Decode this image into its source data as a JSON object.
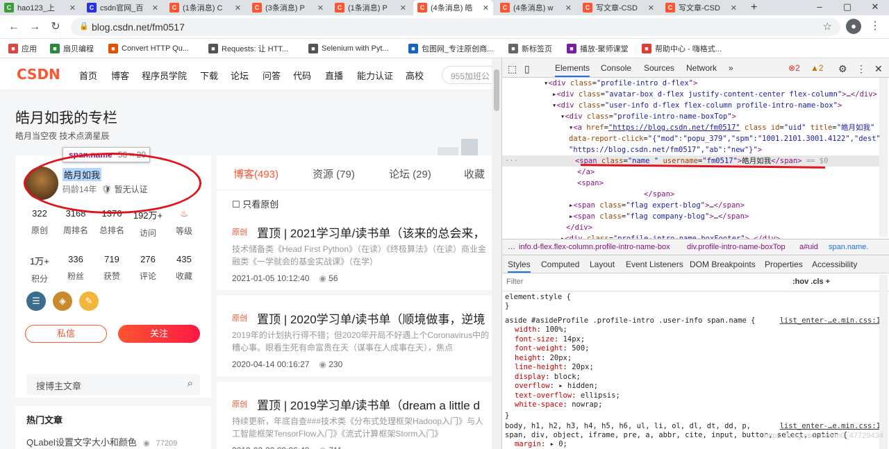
{
  "browser": {
    "tabs": [
      {
        "title": "hao123_上",
        "icon": "hao123-icon",
        "color": "#3a9c3a",
        "active": false
      },
      {
        "title": "csdn官网_百",
        "icon": "baidu-paw-icon",
        "color": "#2932e1",
        "active": false
      },
      {
        "title": "(1条消息) C",
        "icon": "csdn-c-icon",
        "color": "#fc5531",
        "active": false
      },
      {
        "title": "(3条消息) P",
        "icon": "csdn-c-icon",
        "color": "#fc5531",
        "active": false
      },
      {
        "title": "(1条消息) P",
        "icon": "csdn-c-icon",
        "color": "#fc5531",
        "active": false
      },
      {
        "title": "(4条消息) 皓",
        "icon": "csdn-c-icon",
        "color": "#fc5531",
        "active": true
      },
      {
        "title": "(4条消息) w",
        "icon": "csdn-c-icon",
        "color": "#fc5531",
        "active": false
      },
      {
        "title": "写文章-CSD",
        "icon": "csdn-c-icon",
        "color": "#fc5531",
        "active": false
      },
      {
        "title": "写文章-CSD",
        "icon": "csdn-c-icon",
        "color": "#fc5531",
        "active": false
      }
    ],
    "new_tab": "+",
    "url": "blog.csdn.net/fm0517",
    "bookmarks": [
      {
        "label": "应用",
        "icon": "apps-grid-icon",
        "color": "#d44"
      },
      {
        "label": "扇贝编程",
        "icon": "shanbay-icon",
        "color": "#2a8a3a"
      },
      {
        "label": "Convert HTTP Qu...",
        "icon": "convert-icon",
        "color": "#e65100"
      },
      {
        "label": "Requests: 让 HTT...",
        "icon": "doc-icon",
        "color": "#555"
      },
      {
        "label": "Selenium with Pyt...",
        "icon": "doc-icon",
        "color": "#555"
      },
      {
        "label": "包图网_专注原创商...",
        "icon": "baotu-icon",
        "color": "#1565c0"
      },
      {
        "label": "新标签页",
        "icon": "globe-icon",
        "color": "#666"
      },
      {
        "label": "播放-聚师课堂",
        "icon": "play-icon",
        "color": "#7b1fa2"
      },
      {
        "label": "帮助中心 - 嗨格式...",
        "icon": "help-icon",
        "color": "#e53935"
      }
    ]
  },
  "csdn": {
    "logo": "CSDN",
    "nav": [
      "首页",
      "博客",
      "程序员学院",
      "下载",
      "论坛",
      "问答",
      "代码",
      "直播",
      "能力认证",
      "高校"
    ],
    "search_placeholder": "955加班公",
    "blog_title": "皓月如我的专栏",
    "blog_subtitle": "皓月当空夜 技术点滴星辰",
    "tooltip_tag": "span.name",
    "tooltip_size": "56 × 20",
    "profile": {
      "name": "皓月如我",
      "age": "码龄14年",
      "auth": "暂无认证",
      "stats1": [
        {
          "n": "322",
          "l": "原创"
        },
        {
          "n": "3168",
          "l": "周排名"
        },
        {
          "n": "1376",
          "l": "总排名"
        },
        {
          "n": "192万+",
          "l": "访问"
        },
        {
          "n": "",
          "l": "等级"
        }
      ],
      "stats2": [
        {
          "n": "1万+",
          "l": "积分"
        },
        {
          "n": "336",
          "l": "粉丝"
        },
        {
          "n": "719",
          "l": "获赞"
        },
        {
          "n": "276",
          "l": "评论"
        },
        {
          "n": "435",
          "l": "收藏"
        }
      ],
      "msg_btn": "私信",
      "follow_btn": "关注"
    },
    "side_search_placeholder": "搜博主文章",
    "hot_title": "热门文章",
    "hot_item": "QLabel设置文字大小和颜色",
    "hot_views": "77209",
    "tabs": [
      "博客(493)",
      "资源 (79)",
      "论坛 (29)",
      "收藏"
    ],
    "only_original": "只看原创",
    "articles": [
      {
        "tag": "原创",
        "title": "置顶 | 2021学习单/读书单（该来的总会来，",
        "desc": "技术储备类《Head First Python》（在读）《终极算法》（在读）商业金融类《一学就会的基金实战课》（在学）",
        "date": "2021-01-05 10:12:40",
        "views": "56"
      },
      {
        "tag": "原创",
        "title": "置顶 | 2020学习单/读书单（顺境做事，逆境",
        "desc": "2019年的计划执行得不错；但2020年开局不好遇上个Coronavirus中的糟心事。眼看生死有命富贵在天（谋事在人成事在天），焦点",
        "date": "2020-04-14 00:16:27",
        "views": "230"
      },
      {
        "tag": "原创",
        "title": "置顶 | 2019学习单/读书单（dream a little d",
        "desc": "持续更新，年底自查###技术类《分布式处理框架Hadoop入门》与人工智能框架TensorFlow入门》《流式计算框架Storm入门》",
        "date": "2019-02-20 09:06:48",
        "views": "711"
      }
    ]
  },
  "devtools": {
    "tabs": [
      "Elements",
      "Console",
      "Sources",
      "Network",
      "»"
    ],
    "errors": "2",
    "warnings": "2",
    "dom": [
      {
        "i": 60,
        "h": "▾<span class=\"tg\">&lt;div</span> <span class=\"an\">class</span>=<span class=\"av\">\"profile-intro d-flex\"</span><span class=\"tg\">&gt;</span>"
      },
      {
        "i": 72,
        "h": "▸<span class=\"tg\">&lt;div</span> <span class=\"an\">class</span>=<span class=\"av\">\"avatar-box d-flex justify-content-center flex-column\"</span><span class=\"tg\">&gt;</span>…<span class=\"tg\">&lt;/div&gt;</span>"
      },
      {
        "i": 72,
        "h": "▾<span class=\"tg\">&lt;div</span> <span class=\"an\">class</span>=<span class=\"av\">\"user-info d-flex flex-column profile-intro-name-box\"</span><span class=\"tg\">&gt;</span>"
      }
    ],
    "breadcrumbs": [
      "…",
      "info.d-flex.flex-column.profile-intro-name-box",
      "div.profile-intro-name-boxTop",
      "a#uid",
      "span.name."
    ],
    "style_tabs": [
      "Styles",
      "Computed",
      "Layout",
      "Event Listeners",
      "DOM Breakpoints",
      "Properties",
      "Accessibility"
    ],
    "filter": "Filter",
    "hov": ":hov  .cls  +",
    "rule_selector": "aside #asideProfile .profile-intro .user-info span.name {",
    "rule_source": "list_enter-…e.min.css:1",
    "rule_props": [
      [
        "width",
        "100%;"
      ],
      [
        "font-size",
        "14px;"
      ],
      [
        "font-weight",
        "500;"
      ],
      [
        "height",
        "20px;"
      ],
      [
        "line-height",
        "20px;"
      ],
      [
        "display",
        "block;"
      ],
      [
        "overflow",
        "▸ hidden;"
      ],
      [
        "text-overflow",
        "ellipsis;"
      ],
      [
        "white-space",
        "nowrap;"
      ]
    ],
    "rule2_selector": "body, h1, h2, h3, h4, h5, h6, ul, li, ol, dl, dt, dd, p,",
    "rule2_selector_b": "span, div, object, iframe, pre, a, abbr, cite, input, button, select, option {",
    "rule2_source": "list_enter-…e.min.css:1",
    "rule2_prop": [
      "margin",
      "▸ 0;"
    ],
    "watermark": "https://blog.csdn.net/m0_47729434"
  }
}
